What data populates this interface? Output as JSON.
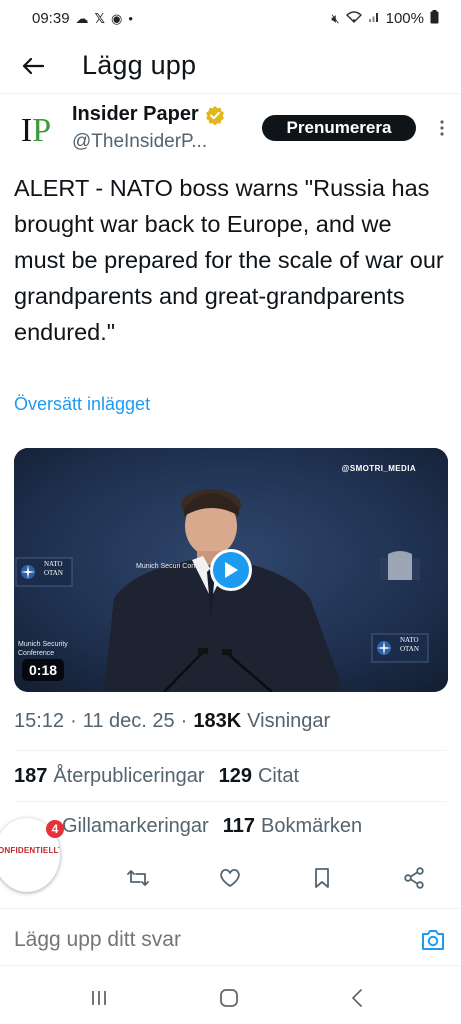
{
  "status_bar": {
    "time": "09:39",
    "left_icons": [
      "cloud-icon",
      "x-icon",
      "messenger-icon",
      "dot"
    ],
    "right_icons": [
      "mute-icon",
      "wifi-icon",
      "signal-icon",
      "battery-icon"
    ],
    "battery": "100%"
  },
  "header": {
    "title": "Lägg upp"
  },
  "author": {
    "name": "Insider Paper",
    "handle": "@TheInsiderP...",
    "avatar_text_1": "I",
    "avatar_text_2": "P",
    "subscribe_label": "Prenumerera"
  },
  "tweet": {
    "text": "ALERT - NATO boss warns \"Russia has brought war back to Europe, and we must be prepared for the scale of war our grandparents and great-grandparents endured.\"",
    "translate_label": "Översätt inlägget"
  },
  "media": {
    "watermark": "@SMOTRI_MEDIA",
    "duration": "0:18",
    "msc_left": "Munich Security Conference",
    "msc_center": "Munich Securi Confer",
    "nato_left": "NATO OTAN",
    "nato_right": "NATO OTAN"
  },
  "meta": {
    "time": "15:12",
    "date": "11 dec. 25",
    "views_count": "183K",
    "views_label": "Visningar"
  },
  "stats": {
    "reposts_count": "187",
    "reposts_label": "Återpubliceringar",
    "quotes_count": "129",
    "quotes_label": "Citat",
    "likes_label": "Gillamarkeringar",
    "bookmarks_count": "117",
    "bookmarks_label": "Bokmärken",
    "overlay_stamp": "ONFIDENTIELLT",
    "notif_count": "4"
  },
  "reply": {
    "placeholder": "Lägg upp ditt svar"
  },
  "colors": {
    "accent": "#1d9bf0",
    "text": "#0f1419",
    "muted": "#536471"
  }
}
